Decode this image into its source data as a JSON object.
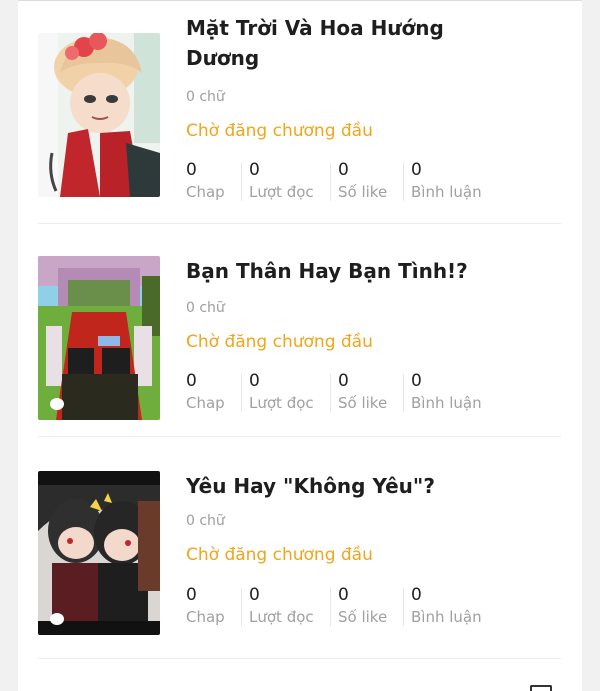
{
  "stories": [
    {
      "title": "Mặt Trời Và Hoa Hướng Dương",
      "word_count": "0 chữ",
      "status": "Chờ đăng chương đầu",
      "stats": [
        {
          "value": "0",
          "label": "Chap"
        },
        {
          "value": "0",
          "label": "Lượt đọc"
        },
        {
          "value": "0",
          "label": "Số like"
        },
        {
          "value": "0",
          "label": "Bình luận"
        }
      ]
    },
    {
      "title": "Bạn Thân Hay Bạn Tình!?",
      "word_count": "0 chữ",
      "status": "Chờ đăng chương đầu",
      "stats": [
        {
          "value": "0",
          "label": "Chap"
        },
        {
          "value": "0",
          "label": "Lượt đọc"
        },
        {
          "value": "0",
          "label": "Số like"
        },
        {
          "value": "0",
          "label": "Bình luận"
        }
      ]
    },
    {
      "title": "Yêu Hay \"Không Yêu\"?",
      "word_count": "0 chữ",
      "status": "Chờ đăng chương đầu",
      "stats": [
        {
          "value": "0",
          "label": "Chap"
        },
        {
          "value": "0",
          "label": "Lượt đọc"
        },
        {
          "value": "0",
          "label": "Số like"
        },
        {
          "value": "0",
          "label": "Bình luận"
        }
      ]
    }
  ],
  "colors": {
    "status": "#f2a51a",
    "title": "#1e1e1e",
    "muted": "#9e9e9e"
  }
}
